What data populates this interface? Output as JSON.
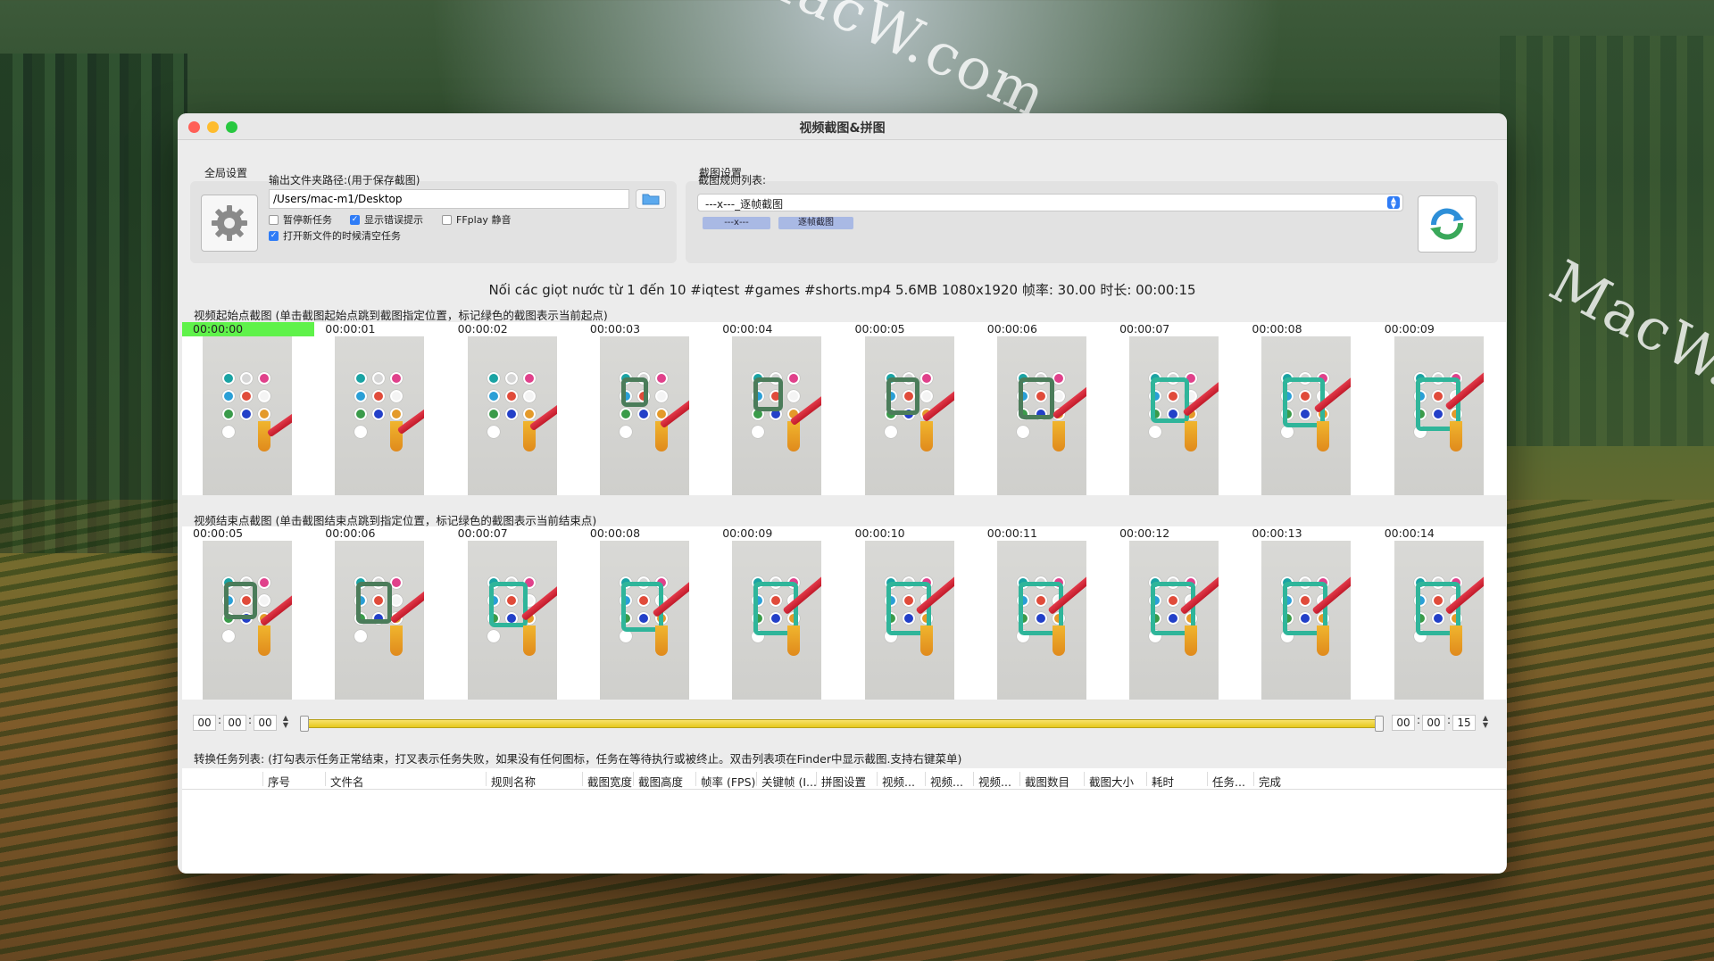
{
  "watermark": "MacW.com",
  "window": {
    "title": "视频截图&拼图"
  },
  "global_settings": {
    "title": "全局设置",
    "output_label": "输出文件夹路径:(用于保存截图)",
    "output_path": "/Users/mac-m1/Desktop",
    "checkboxes": [
      {
        "label": "暂停新任务",
        "checked": false
      },
      {
        "label": "显示错误提示",
        "checked": true
      },
      {
        "label": "FFplay 静音",
        "checked": false
      },
      {
        "label": "打开新文件的时候清空任务",
        "checked": true
      }
    ]
  },
  "capture_settings": {
    "title": "截图设置",
    "rules_label": "截图规则列表:",
    "selected_rule": "---x---_逐帧截图",
    "chips": [
      "---x---",
      "逐帧截图"
    ]
  },
  "video_info": "Nối các giọt nước từ 1 đến 10 #iqtest #games #shorts.mp4    5.6MB    1080x1920    帧率: 30.00    时长: 00:00:15",
  "start_strip": {
    "title": "视频起始点截图 (单击截图起始点跳到截图指定位置，标记绿色的截图表示当前起点)",
    "timestamps": [
      "00:00:00",
      "00:00:01",
      "00:00:02",
      "00:00:03",
      "00:00:04",
      "00:00:05",
      "00:00:06",
      "00:00:07",
      "00:00:08",
      "00:00:09"
    ],
    "active_index": 0
  },
  "end_strip": {
    "title": "视频结束点截图 (单击截图结束点跳到指定位置，标记绿色的截图表示当前结束点)",
    "timestamps": [
      "00:00:05",
      "00:00:06",
      "00:00:07",
      "00:00:08",
      "00:00:09",
      "00:00:10",
      "00:00:11",
      "00:00:12",
      "00:00:13",
      "00:00:14"
    ]
  },
  "range": {
    "start": {
      "h": "00",
      "m": "00",
      "s": "00"
    },
    "end": {
      "h": "00",
      "m": "00",
      "s": "15"
    },
    "start_fraction": 0.0,
    "end_fraction": 1.0
  },
  "tasks": {
    "title": "转换任务列表: (打勾表示任务正常结束，打叉表示任务失败，如果没有任何图标，任务在等待执行或被终止。双击列表项在Finder中显示截图.支持右键菜单)",
    "columns": [
      "序号",
      "文件名",
      "规则名称",
      "截图宽度",
      "截图高度",
      "帧率 (FPS)",
      "关键帧 (I...",
      "拼图设置",
      "视频...",
      "视频...",
      "视频...",
      "截图数目",
      "截图大小",
      "耗时",
      "任务...",
      "完成"
    ]
  }
}
